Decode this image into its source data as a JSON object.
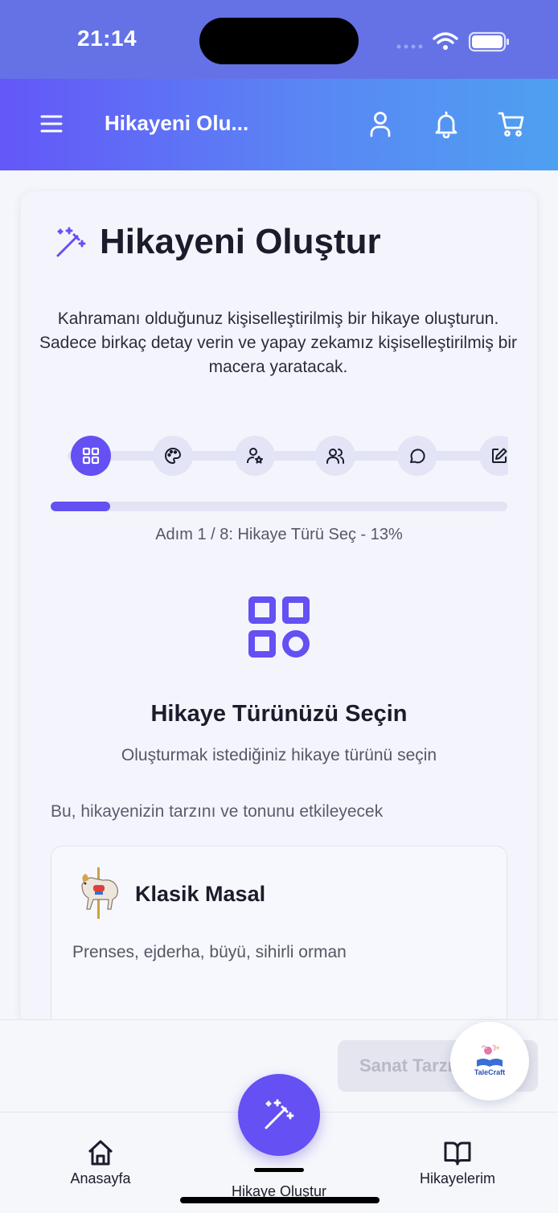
{
  "status_bar": {
    "time": "21:14"
  },
  "header": {
    "title": "Hikayeni Olu...",
    "icons": [
      "menu-icon",
      "user-icon",
      "bell-icon",
      "cart-icon"
    ]
  },
  "card": {
    "title": "Hikayeni Oluştur",
    "description": "Kahramanı olduğunuz kişiselleştirilmiş bir hikaye oluşturun. Sadece birkaç detay verin ve yapay zekamız kişiselleştirilmiş bir macera yaratacak.",
    "steps": [
      {
        "icon": "grid-icon",
        "active": true
      },
      {
        "icon": "palette-icon",
        "active": false
      },
      {
        "icon": "user-star-icon",
        "active": false
      },
      {
        "icon": "users-icon",
        "active": false
      },
      {
        "icon": "chat-icon",
        "active": false
      },
      {
        "icon": "edit-icon",
        "active": false
      }
    ],
    "progress": {
      "current": 1,
      "total": 8,
      "percent": 13,
      "text": "Adım 1 / 8: Hikaye Türü Seç - 13%"
    },
    "section": {
      "title": "Hikaye Türünüzü Seçin",
      "subtitle": "Oluşturmak istediğiniz hikaye türünü seçin",
      "hint": "Bu, hikayenizin tarzını ve tonunu etkileyecek"
    },
    "options": [
      {
        "title": "Klasik Masal",
        "description": "Prenses, ejderha, büyü, sihirli orman",
        "icon": "carousel-horse-icon"
      }
    ]
  },
  "actions": {
    "next_label": "Sanat Tarzı",
    "fab_brand": "TaleCraft"
  },
  "tab_bar": {
    "items": [
      {
        "label": "Anasayfa",
        "icon": "home-icon"
      },
      {
        "label": "Hikaye Oluştur",
        "icon": "magic-wand-icon"
      },
      {
        "label": "Hikayelerim",
        "icon": "book-icon"
      }
    ]
  },
  "colors": {
    "accent": "#6450f3",
    "header_start": "#6457f8",
    "header_end": "#4ea0f1",
    "status_bar": "#6472e6"
  }
}
